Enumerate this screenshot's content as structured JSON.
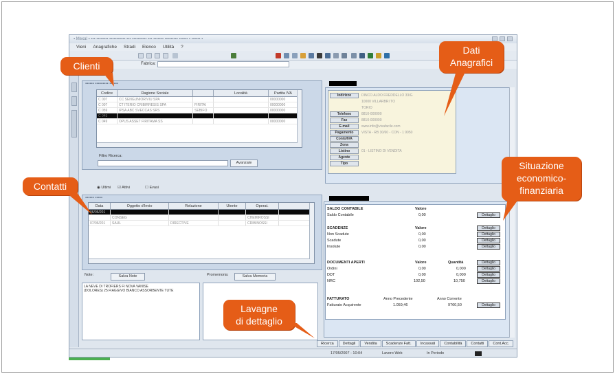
{
  "callouts": {
    "clienti": "Clienti",
    "dati": "Dati\nAnagrafici",
    "situazione": "Situazione\neconomico-\nfinanziaria",
    "contatti": "Contatti",
    "lavagne": "Lavagne\ndi dettaglio"
  },
  "menu": [
    "Vieni",
    "Anagrafiche",
    "Stradi",
    "Elenco",
    "Utilità",
    "?"
  ],
  "address_label": "Fabrica:",
  "clients": {
    "columns": [
      "Codice",
      "Ragione Sociale",
      "",
      "Località",
      "Partita IVA"
    ],
    "rows": [
      [
        "C 007",
        "CC SENGUNIORIVIU SPA",
        "",
        "",
        "00000000"
      ],
      [
        "C 007",
        "CT ITERIO CRIBIRRESIS SPA",
        "FIRITAI",
        "",
        "00000000"
      ],
      [
        "C 059",
        "IPSA ABC SVECCAS SRS",
        "SEBIFO",
        "",
        "00000000"
      ],
      [
        "C 045",
        "",
        "",
        "",
        ""
      ],
      [
        "C 049",
        "OPUS ASSET FIRITAMA SS",
        "",
        "",
        "00000000"
      ]
    ],
    "filter_label": "Filtro Ricerca:",
    "filter_button": "Avanzate"
  },
  "contact_options": [
    "Ultimi",
    "Attivi",
    "Evasi"
  ],
  "contacts": {
    "columns": [
      "Data",
      "Oggetto d'Invio",
      "Relazione",
      "Utente",
      "Operat."
    ],
    "rows": [
      [
        "06/06/201",
        "",
        "",
        "",
        ""
      ],
      [
        "",
        "CONSEG",
        "",
        "",
        "CHEMIROSSI"
      ],
      [
        "07/06/201",
        "SAUL",
        "DIRECTIVE",
        "",
        "CRIBINOSSI"
      ]
    ]
  },
  "note": {
    "label": "Note:",
    "button": "Salva Note",
    "text": "LA NEVE DI TROFIERS FI NOVA VANISE\n(DOLORES) 25 FIAGGIVO BIANCO ASSORBENTE TUTE"
  },
  "promemoria": {
    "label": "Promemoria:",
    "button": "Salva Memoria"
  },
  "anagrafica": {
    "fields": [
      [
        "Indirizzo",
        "DINCO ALDO FREDDELLO 33/G"
      ],
      [
        "",
        "10000 VILLARBRI TO"
      ],
      [
        "",
        "TORIO"
      ],
      [
        "Telefono",
        "8810-000000"
      ],
      [
        "Fax",
        "8810-000000"
      ],
      [
        "E-mail",
        "www.info@vivafacile.com"
      ],
      [
        "Pagamento",
        "VISTA - RB 30/60 - CON - 1 9050"
      ],
      [
        "Conto/IVA",
        ""
      ],
      [
        "Zona",
        ""
      ],
      [
        "Listino",
        "01 - LISTINO DI VENDITA"
      ],
      [
        "Agente",
        ""
      ],
      [
        "Tipo",
        ""
      ]
    ]
  },
  "finance": {
    "saldo_header": "SALDO CONTABILE",
    "saldo_header_col": "Valore",
    "saldo_row": [
      "Saldo Contabile",
      "0,00"
    ],
    "scadenze_header": "SCADENZE",
    "scadenze_col": "Valore",
    "scadenze_rows": [
      [
        "Non Scadute",
        "0,00"
      ],
      [
        "Scadute",
        "0,00"
      ],
      [
        "Insolute",
        "0,00"
      ]
    ],
    "doc_header": "DOCUMENTI APERTI",
    "doc_cols": [
      "Valore",
      "Quantità"
    ],
    "doc_rows": [
      [
        "Ordini",
        "0,00",
        "0,000"
      ],
      [
        "DDT",
        "0,00",
        "0,000"
      ],
      [
        "NRC",
        "102,50",
        "10,750"
      ]
    ],
    "fatt_header": "FATTURATO",
    "fatt_cols": [
      "Anno Precedente",
      "Anno Corrente"
    ],
    "fatt_row": [
      "Fatturato Acquirente",
      "1.059,46",
      "9760,50"
    ],
    "detail_button": "Dettaglio"
  },
  "tabs": [
    "Ricerca",
    "Dettagli",
    "Vendita",
    "Scadenze Fatt.",
    "Incassati",
    "Contabilità",
    "Contatti",
    "Cont.Acc."
  ],
  "status": [
    "17/05/2007 - 10:04",
    "Lavoro Web",
    "In Periodo"
  ]
}
